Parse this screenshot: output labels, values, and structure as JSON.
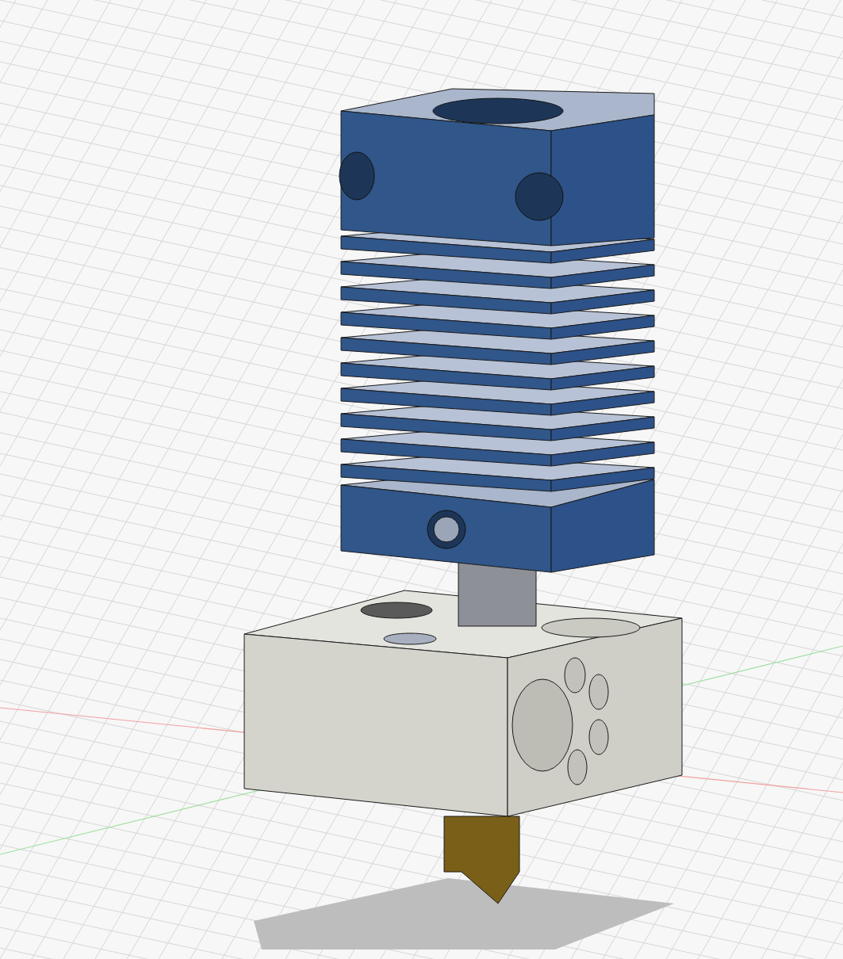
{
  "viewport": {
    "grid": true,
    "axes": true,
    "shadow": true
  }
}
